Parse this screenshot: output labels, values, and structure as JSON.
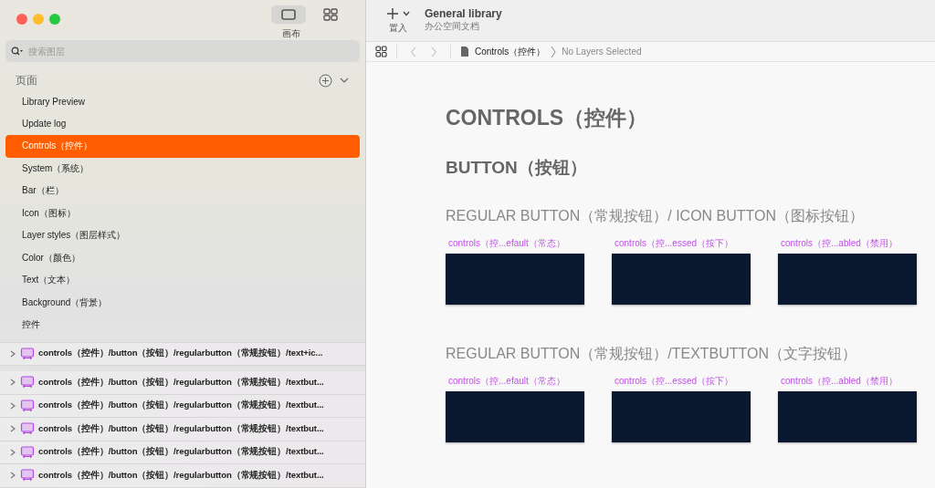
{
  "sidebar": {
    "view_toggle": [
      {
        "kind": "canvas",
        "selected": true
      },
      {
        "kind": "grid",
        "selected": false
      }
    ],
    "view_label": "画布",
    "search": {
      "placeholder": "搜索图层"
    },
    "pages_header": "页面",
    "pages": [
      {
        "label": "Library Preview",
        "selected": false
      },
      {
        "label": "Update log",
        "selected": false
      },
      {
        "label": "Controls（控件）",
        "selected": true
      },
      {
        "label": "System（系统）",
        "selected": false
      },
      {
        "label": "Bar（栏）",
        "selected": false
      },
      {
        "label": "Icon（图标）",
        "selected": false
      },
      {
        "label": "Layer styles（图层样式）",
        "selected": false
      },
      {
        "label": "Color（颜色）",
        "selected": false
      },
      {
        "label": "Text（文本）",
        "selected": false
      },
      {
        "label": "Background（背景）",
        "selected": false
      },
      {
        "label": "控件",
        "selected": false
      }
    ],
    "layers": [
      {
        "name": "controls（控件）/button（按钮）/regularbutton（常规按钮）/text+ic...",
        "expanded": false
      },
      {
        "name": "controls（控件）/button（按钮）/regularbutton（常规按钮）/textbut...",
        "expanded": false
      },
      {
        "name": "controls（控件）/button（按钮）/regularbutton（常规按钮）/textbut...",
        "expanded": false
      },
      {
        "name": "controls（控件）/button（按钮）/regularbutton（常规按钮）/textbut...",
        "expanded": false
      },
      {
        "name": "controls（控件）/button（按钮）/regularbutton（常规按钮）/textbut...",
        "expanded": false
      },
      {
        "name": "controls（控件）/button（按钮）/regularbutton（常规按钮）/textbut...",
        "expanded": false
      }
    ]
  },
  "toolbar": {
    "insert_label": "置入",
    "document": {
      "title": "General library",
      "subtitle": "办公空间文档"
    }
  },
  "breadcrumb": {
    "back": {
      "disabled": true
    },
    "forward": {
      "disabled": true
    },
    "page": "Controls（控件）",
    "selection": "No Layers Selected"
  },
  "canvas": {
    "title": "CONTROLS（控件）",
    "section": "BUTTON（按钮）",
    "groups": [
      {
        "heading": "REGULAR BUTTON（常规按钮）/ ICON BUTTON（图标按钮）",
        "artboards": [
          {
            "label": "controls（控...efault（常态）"
          },
          {
            "label": "controls（控...essed（按下）"
          },
          {
            "label": "controls（控...abled（禁用）"
          }
        ]
      },
      {
        "heading": "REGULAR BUTTON（常规按钮）/TEXTBUTTON（文字按钮）",
        "artboards": [
          {
            "label": "controls（控...efault（常态）"
          },
          {
            "label": "controls（控...essed（按下）"
          },
          {
            "label": "controls（控...abled（禁用）"
          }
        ]
      }
    ]
  }
}
